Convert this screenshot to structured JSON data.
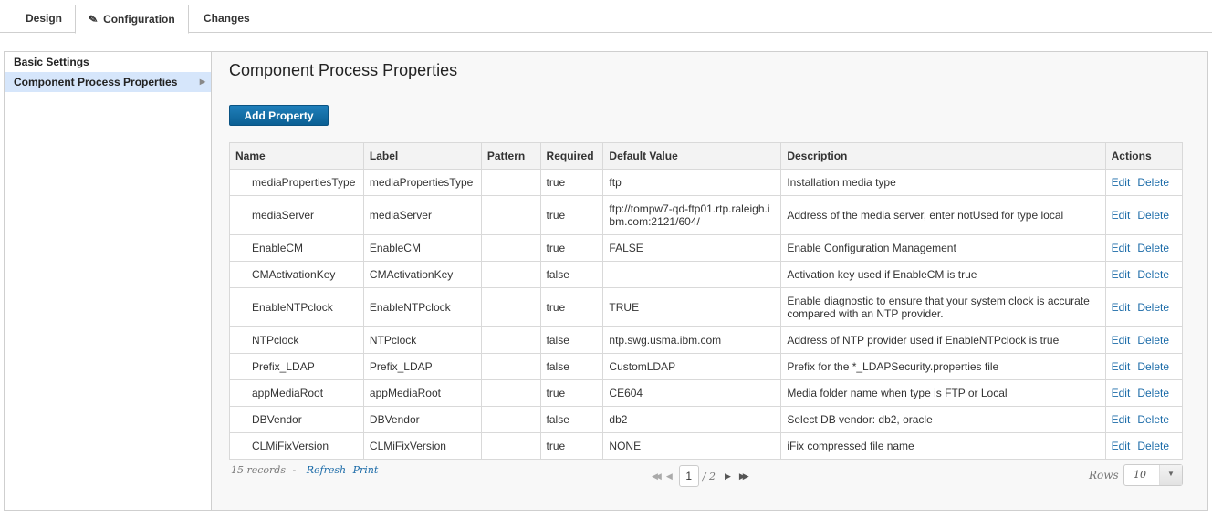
{
  "tabs": [
    {
      "label": "Design",
      "active": false
    },
    {
      "label": "Configuration",
      "active": true,
      "icon": "pencil-icon"
    },
    {
      "label": "Changes",
      "active": false
    }
  ],
  "sidebar": {
    "items": [
      {
        "label": "Basic Settings",
        "selected": false
      },
      {
        "label": "Component Process Properties",
        "selected": true
      }
    ]
  },
  "main": {
    "title": "Component Process Properties",
    "add_button": "Add Property",
    "table": {
      "columns": [
        "Name",
        "Label",
        "Pattern",
        "Required",
        "Default Value",
        "Description",
        "Actions"
      ],
      "rows": [
        {
          "name": "mediaPropertiesType",
          "label": "mediaPropertiesType",
          "pattern": "",
          "required": "true",
          "default": "ftp",
          "description": "Installation media type"
        },
        {
          "name": "mediaServer",
          "label": "mediaServer",
          "pattern": "",
          "required": "true",
          "default": "ftp://tompw7-qd-ftp01.rtp.raleigh.ibm.com:2121/604/",
          "description": "Address of the media server, enter notUsed for type local"
        },
        {
          "name": "EnableCM",
          "label": "EnableCM",
          "pattern": "",
          "required": "true",
          "default": "FALSE",
          "description": "Enable Configuration Management"
        },
        {
          "name": "CMActivationKey",
          "label": "CMActivationKey",
          "pattern": "",
          "required": "false",
          "default": "",
          "description": "Activation key used if EnableCM is true"
        },
        {
          "name": "EnableNTPclock",
          "label": "EnableNTPclock",
          "pattern": "",
          "required": "true",
          "default": "TRUE",
          "description": "Enable diagnostic to ensure that your system clock is accurate compared with an NTP provider."
        },
        {
          "name": "NTPclock",
          "label": "NTPclock",
          "pattern": "",
          "required": "false",
          "default": "ntp.swg.usma.ibm.com",
          "description": "Address of NTP provider used if EnableNTPclock is true"
        },
        {
          "name": "Prefix_LDAP",
          "label": "Prefix_LDAP",
          "pattern": "",
          "required": "false",
          "default": "CustomLDAP",
          "description": "Prefix for the *_LDAPSecurity.properties file"
        },
        {
          "name": "appMediaRoot",
          "label": "appMediaRoot",
          "pattern": "",
          "required": "true",
          "default": "CE604",
          "description": "Media folder name when type is FTP or Local"
        },
        {
          "name": "DBVendor",
          "label": "DBVendor",
          "pattern": "",
          "required": "false",
          "default": "db2",
          "description": "Select DB vendor: db2, oracle"
        },
        {
          "name": "CLMiFixVersion",
          "label": "CLMiFixVersion",
          "pattern": "",
          "required": "true",
          "default": "NONE",
          "description": "iFix compressed file name"
        }
      ],
      "actions": {
        "edit": "Edit",
        "delete": "Delete"
      }
    },
    "footer": {
      "records": "15 records",
      "separator": "-",
      "refresh": "Refresh",
      "print": "Print",
      "current_page": "1",
      "total_pages": "/ 2",
      "rows_label": "Rows",
      "rows_value": "10"
    }
  }
}
